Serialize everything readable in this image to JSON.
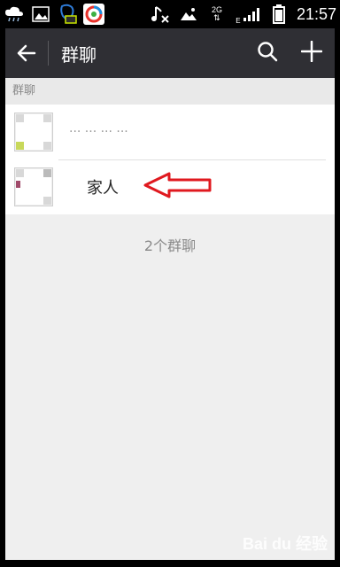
{
  "status_bar": {
    "time": "21:57",
    "network": "2G",
    "network_sub": "E"
  },
  "header": {
    "title": "群聊"
  },
  "section": {
    "label": "群聊"
  },
  "groups": [
    {
      "name": "··· ··· ··· ···"
    },
    {
      "name": "家人"
    }
  ],
  "footer": {
    "count_text": "2个群聊"
  },
  "watermark": "Bai du 经验",
  "colors": {
    "titlebar": "#2f2f34",
    "background": "#efefef",
    "arrow": "#e0191f"
  }
}
